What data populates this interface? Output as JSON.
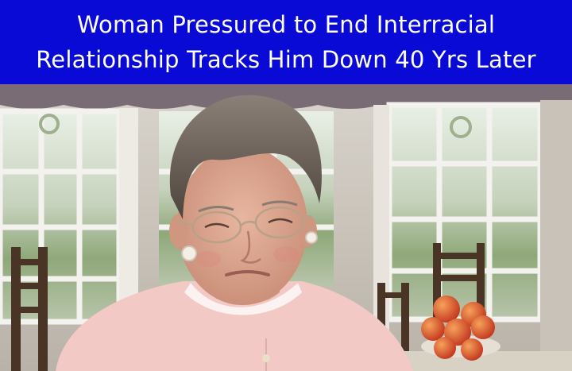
{
  "headline": {
    "line1": "Woman Pressured to End Interracial",
    "line2": "Relationship Tracks Him Down 40 Yrs Later"
  },
  "colors": {
    "banner_bg": "#0a0ad6",
    "banner_text": "#ffffff"
  }
}
